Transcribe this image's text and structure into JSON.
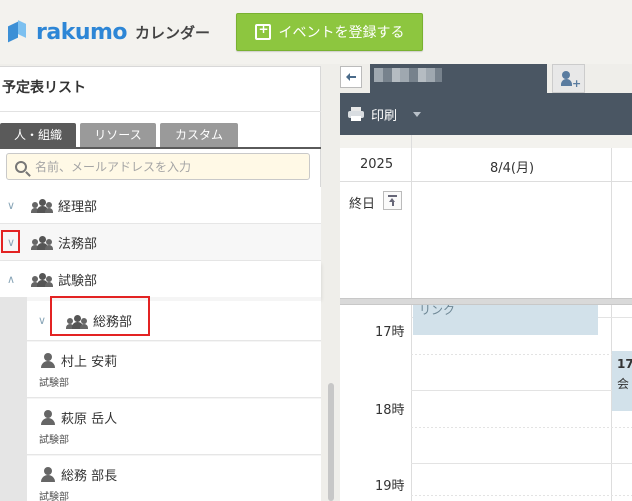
{
  "header": {
    "logo_text": "rakumo",
    "logo_sub": "カレンダー",
    "register_button": "イベントを登録する"
  },
  "sidebar": {
    "title": "予定表リスト",
    "tabs": [
      "人・組織",
      "リソース",
      "カスタム"
    ],
    "active_tab": 0,
    "search_placeholder": "名前、メールアドレスを入力",
    "groups": [
      {
        "label": "経理部",
        "expanded": false
      },
      {
        "label": "法務部",
        "expanded": false,
        "highlighted": true
      },
      {
        "label": "試験部",
        "expanded": true
      }
    ],
    "subgroup": {
      "label": "総務部",
      "highlighted": true
    },
    "members": [
      {
        "name": "村上 安莉",
        "dept": "試験部"
      },
      {
        "name": "萩原 岳人",
        "dept": "試験部"
      },
      {
        "name": "総務 部長",
        "dept": "試験部"
      }
    ]
  },
  "calendar": {
    "print_label": "印刷",
    "year": "2025",
    "date": "8/4(月)",
    "allday_label": "終日",
    "hours": [
      "17時",
      "18時",
      "19時"
    ],
    "events": [
      {
        "text": "リンク"
      },
      {
        "line1": "17",
        "line2": "会"
      }
    ]
  }
}
